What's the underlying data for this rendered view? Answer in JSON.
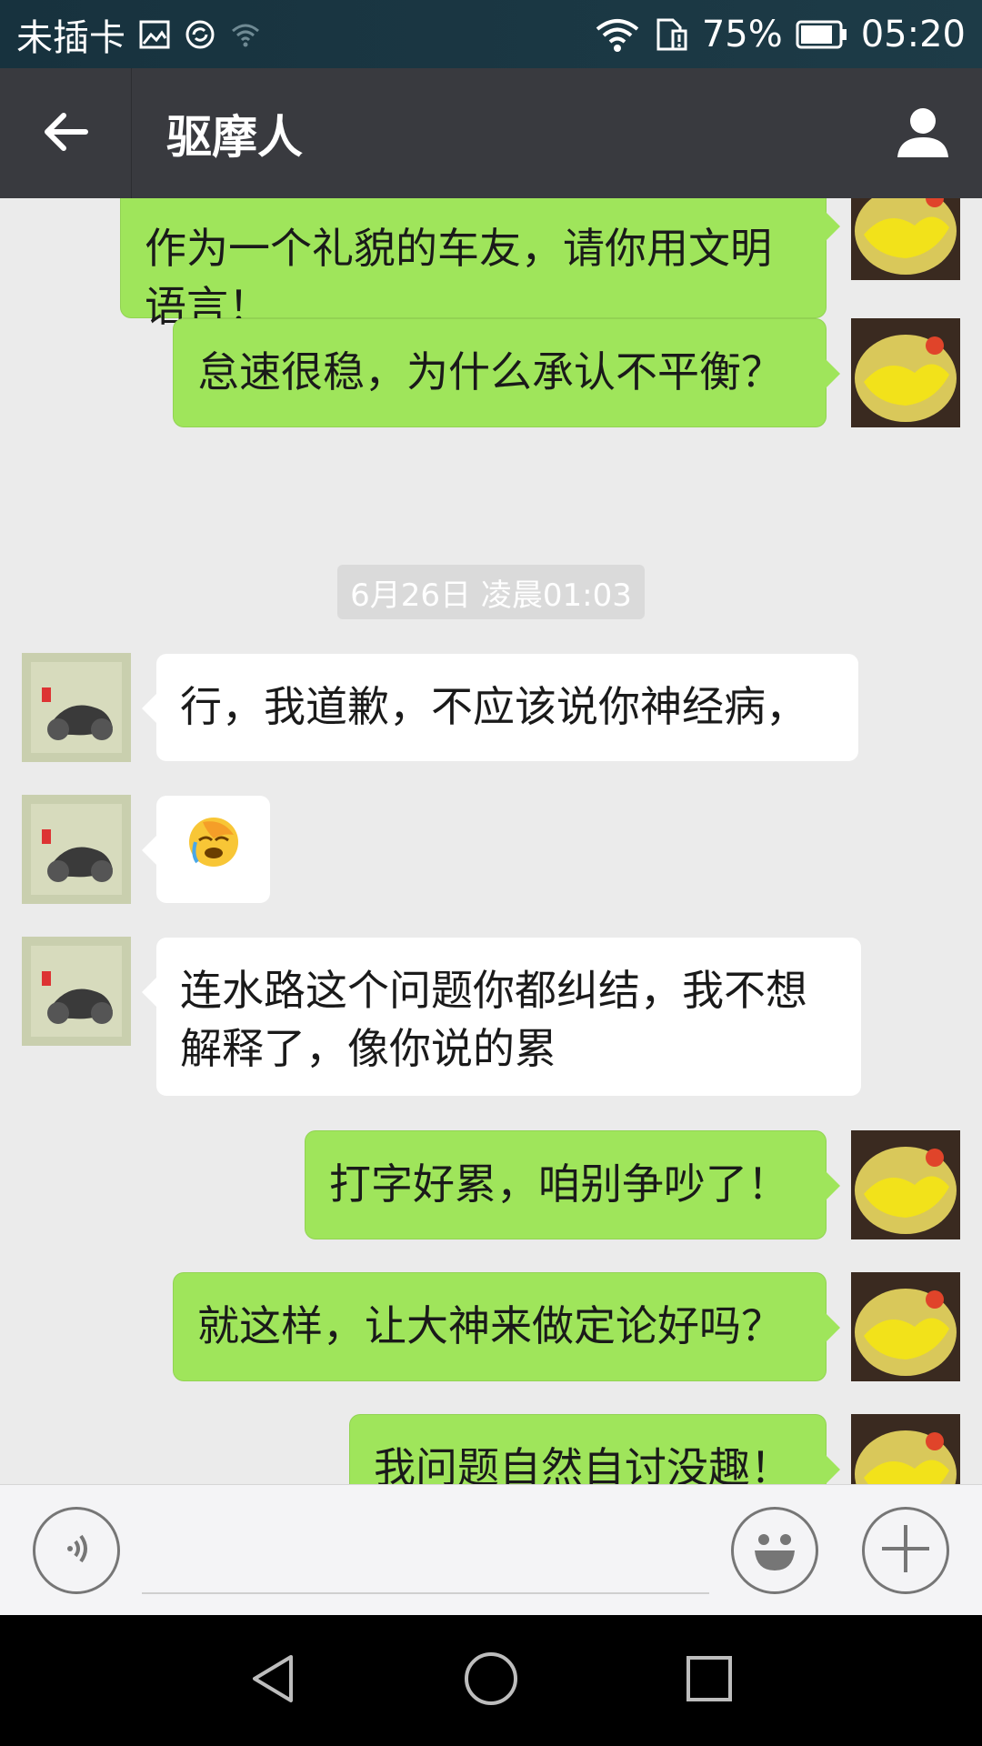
{
  "status_bar": {
    "carrier": "未插卡",
    "battery": "75%",
    "time": "05:20",
    "icons": [
      "image-icon",
      "sync-icon",
      "wifi-question-icon",
      "wifi-icon",
      "sim-alert-icon",
      "battery-icon"
    ]
  },
  "header": {
    "title": "驱摩人",
    "back_icon": "arrow-left-icon",
    "profile_icon": "person-icon"
  },
  "messages": [
    {
      "side": "right",
      "text": "作为一个礼貌的车友，请你用文明语言！"
    },
    {
      "side": "right",
      "text": "怠速很稳，为什么承认不平衡？"
    },
    {
      "type": "time",
      "text": "6月26日 凌晨01:03"
    },
    {
      "side": "left",
      "text": "行，我道歉，不应该说你神经病，"
    },
    {
      "side": "left",
      "text": "😭",
      "emoji": true
    },
    {
      "side": "left",
      "text": "连水路这个问题你都纠结，我不想解释了，像你说的累"
    },
    {
      "side": "right",
      "text": "打字好累，咱别争吵了！"
    },
    {
      "side": "right",
      "text": "就这样，让大神来做定论好吗？"
    },
    {
      "side": "right",
      "text": "我问题自然自讨没趣！"
    }
  ],
  "input_bar": {
    "voice_icon": "voice-icon",
    "emoji_icon": "smiley-icon",
    "plus_icon": "plus-icon"
  },
  "nav_bar": {
    "icons": [
      "back-triangle-icon",
      "home-circle-icon",
      "recents-square-icon"
    ]
  },
  "colors": {
    "status_bar": "#17323e",
    "header": "#393a3f",
    "chat_bg": "#ebebeb",
    "bubble_green": "#9fe55b",
    "bubble_white": "#ffffff"
  }
}
